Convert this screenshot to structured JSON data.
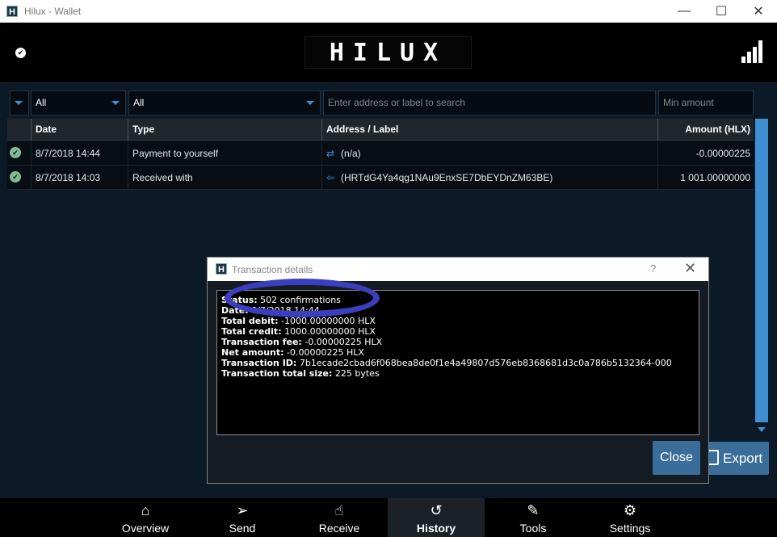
{
  "window": {
    "title": "Hilux - Wallet",
    "app_icon": "H"
  },
  "header": {
    "logo_text": "HILUX",
    "sync_icon": "check-icon",
    "network_icon": "signal-bars-icon"
  },
  "filters": {
    "type_filter": "All",
    "date_filter": "All",
    "search_placeholder": "Enter address or label to search",
    "min_amount_placeholder": "Min amount"
  },
  "table": {
    "columns": [
      "Date",
      "Type",
      "Address / Label",
      "Amount (HLX)"
    ],
    "rows": [
      {
        "date": "8/7/2018 14:44",
        "type": "Payment to yourself",
        "address": "(n/a)",
        "amount": "-0.00000225",
        "dir_icon": "self-transfer-icon"
      },
      {
        "date": "8/7/2018 14:03",
        "type": "Received with",
        "address": "(HRTdG4Ya4qg1NAu9EnxSE7DbEYDnZM63BE)",
        "amount": "1 001.00000000",
        "dir_icon": "receive-arrow-icon"
      }
    ]
  },
  "export_label": "Export",
  "dialog": {
    "title": "Transaction details",
    "help": "?",
    "close_glyph": "✕",
    "lines": [
      {
        "label": "Status:",
        "value": " 502 confirmations"
      },
      {
        "label": "Date:",
        "value": " 8/7/2018 14:44"
      },
      {
        "label": "Total debit:",
        "value": " -1000.00000000 HLX"
      },
      {
        "label": "Total credit:",
        "value": " 1000.00000000 HLX"
      },
      {
        "label": "Transaction fee:",
        "value": " -0.00000225 HLX"
      },
      {
        "label": "Net amount:",
        "value": " -0.00000225 HLX"
      },
      {
        "label": "Transaction ID:",
        "value": " 7b1ecade2cbad6f068bea8de0f1e4a49807d576eb8368681d3c0a786b5132364-000"
      },
      {
        "label": "Transaction total size:",
        "value": " 225 bytes"
      }
    ],
    "close_button": "Close"
  },
  "nav": [
    {
      "label": "Overview",
      "icon": "home-icon",
      "glyph": "⌂"
    },
    {
      "label": "Send",
      "icon": "send-icon",
      "glyph": "➢"
    },
    {
      "label": "Receive",
      "icon": "receive-icon",
      "glyph": "☝"
    },
    {
      "label": "History",
      "icon": "history-icon",
      "glyph": "↺"
    },
    {
      "label": "Tools",
      "icon": "wrench-icon",
      "glyph": "✎"
    },
    {
      "label": "Settings",
      "icon": "gear-icon",
      "glyph": "⚙"
    }
  ],
  "colors": {
    "accent": "#3f8fd2",
    "button": "#3a6d99",
    "background": "#0b1a26",
    "annotation": "#3b3fbf"
  }
}
